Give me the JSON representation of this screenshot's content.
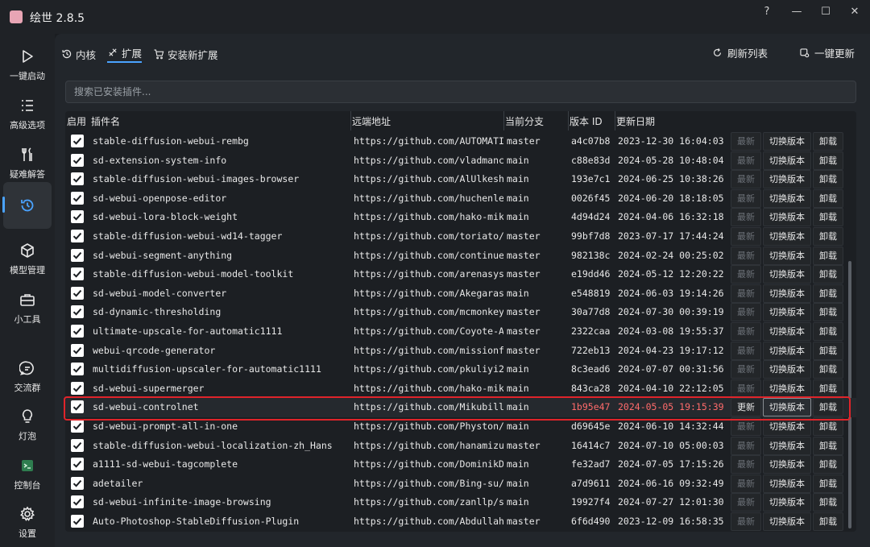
{
  "window": {
    "title": "绘世 2.8.5",
    "controls": [
      "?",
      "—",
      "☐",
      "✕"
    ]
  },
  "sidebar": {
    "items": [
      {
        "label": "一键启动",
        "icon": "play-icon"
      },
      {
        "label": "高级选项",
        "icon": "list-icon"
      },
      {
        "label": "疑难解答",
        "icon": "tools-icon"
      },
      {
        "label": "",
        "icon": "history-icon",
        "active": true
      },
      {
        "label": "模型管理",
        "icon": "cube-icon"
      },
      {
        "label": "小工具",
        "icon": "toolbox-icon"
      },
      {
        "label": "交流群",
        "icon": "chat-icon"
      },
      {
        "label": "灯泡",
        "icon": "bulb-icon"
      },
      {
        "label": "控制台",
        "icon": "terminal-icon"
      },
      {
        "label": "设置",
        "icon": "gear-icon"
      }
    ]
  },
  "tabs": [
    {
      "label": "内核",
      "icon": "history-icon"
    },
    {
      "label": "扩展",
      "icon": "puzzle-icon",
      "active": true
    },
    {
      "label": "安装新扩展",
      "icon": "cart-icon"
    }
  ],
  "actions": {
    "refresh": "刷新列表",
    "update_all": "一键更新"
  },
  "search": {
    "placeholder": "搜索已安装插件..."
  },
  "table": {
    "headers": [
      "启用",
      "插件名",
      "远端地址",
      "当前分支",
      "版本 ID",
      "更新日期"
    ],
    "buttons": {
      "update": "最新",
      "update_active": "更新",
      "switch": "切换版本",
      "uninstall": "卸载"
    },
    "rows": [
      {
        "name": "stable-diffusion-webui-rembg",
        "url": "https://github.com/AUTOMATI",
        "branch": "master",
        "ver": "a4c07b8",
        "date": "2023-12-30 16:04:03"
      },
      {
        "name": "sd-extension-system-info",
        "url": "https://github.com/vladmanc",
        "branch": "main",
        "ver": "c88e83d",
        "date": "2024-05-28 10:48:04"
      },
      {
        "name": "stable-diffusion-webui-images-browser",
        "url": "https://github.com/AlUlkesh",
        "branch": "main",
        "ver": "193e7c1",
        "date": "2024-06-25 10:38:26"
      },
      {
        "name": "sd-webui-openpose-editor",
        "url": "https://github.com/huchenle",
        "branch": "main",
        "ver": "0026f45",
        "date": "2024-06-20 18:18:05"
      },
      {
        "name": "sd-webui-lora-block-weight",
        "url": "https://github.com/hako-mik",
        "branch": "main",
        "ver": "4d94d24",
        "date": "2024-04-06 16:32:18"
      },
      {
        "name": "stable-diffusion-webui-wd14-tagger",
        "url": "https://github.com/toriato/",
        "branch": "master",
        "ver": "99bf7d8",
        "date": "2023-07-17 17:44:24"
      },
      {
        "name": "sd-webui-segment-anything",
        "url": "https://github.com/continue",
        "branch": "master",
        "ver": "982138c",
        "date": "2024-02-24 00:25:02"
      },
      {
        "name": "stable-diffusion-webui-model-toolkit",
        "url": "https://github.com/arenasys",
        "branch": "master",
        "ver": "e19dd46",
        "date": "2024-05-12 12:20:22"
      },
      {
        "name": "sd-webui-model-converter",
        "url": "https://github.com/Akegaras",
        "branch": "main",
        "ver": "e548819",
        "date": "2024-06-03 19:14:26"
      },
      {
        "name": "sd-dynamic-thresholding",
        "url": "https://github.com/mcmonkey",
        "branch": "master",
        "ver": "30a77d8",
        "date": "2024-07-30 00:39:19"
      },
      {
        "name": "ultimate-upscale-for-automatic1111",
        "url": "https://github.com/Coyote-A",
        "branch": "master",
        "ver": "2322caa",
        "date": "2024-03-08 19:55:37"
      },
      {
        "name": "webui-qrcode-generator",
        "url": "https://github.com/missionf",
        "branch": "master",
        "ver": "722eb13",
        "date": "2024-04-23 19:17:12"
      },
      {
        "name": "multidiffusion-upscaler-for-automatic1111",
        "url": "https://github.com/pkuliyi2",
        "branch": "main",
        "ver": "8c3ead6",
        "date": "2024-07-07 00:31:56"
      },
      {
        "name": "sd-webui-supermerger",
        "url": "https://github.com/hako-mik",
        "branch": "main",
        "ver": "843ca28",
        "date": "2024-04-10 22:12:05"
      },
      {
        "name": "sd-webui-controlnet",
        "url": "https://github.com/Mikubill",
        "branch": "main",
        "ver": "1b95e47",
        "date": "2024-05-05 19:15:39",
        "highlight": true
      },
      {
        "name": "sd-webui-prompt-all-in-one",
        "url": "https://github.com/Physton/",
        "branch": "main",
        "ver": "d69645e",
        "date": "2024-06-10 14:32:44"
      },
      {
        "name": "stable-diffusion-webui-localization-zh_Hans",
        "url": "https://github.com/hanamizu",
        "branch": "master",
        "ver": "16414c7",
        "date": "2024-07-10 05:00:03"
      },
      {
        "name": "a1111-sd-webui-tagcomplete",
        "url": "https://github.com/DominikD",
        "branch": "main",
        "ver": "fe32ad7",
        "date": "2024-07-05 17:15:26"
      },
      {
        "name": "adetailer",
        "url": "https://github.com/Bing-su/",
        "branch": "main",
        "ver": "a7d9611",
        "date": "2024-06-16 09:32:49"
      },
      {
        "name": "sd-webui-infinite-image-browsing",
        "url": "https://github.com/zanllp/s",
        "branch": "main",
        "ver": "19927f4",
        "date": "2024-07-27 12:01:30"
      },
      {
        "name": "Auto-Photoshop-StableDiffusion-Plugin",
        "url": "https://github.com/Abdullah",
        "branch": "master",
        "ver": "6f6d490",
        "date": "2023-12-09 16:58:35"
      }
    ]
  },
  "colors": {
    "accent": "#4aa3ff",
    "highlight_text": "#ff6b6b",
    "highlight_box": "#e0242a"
  }
}
